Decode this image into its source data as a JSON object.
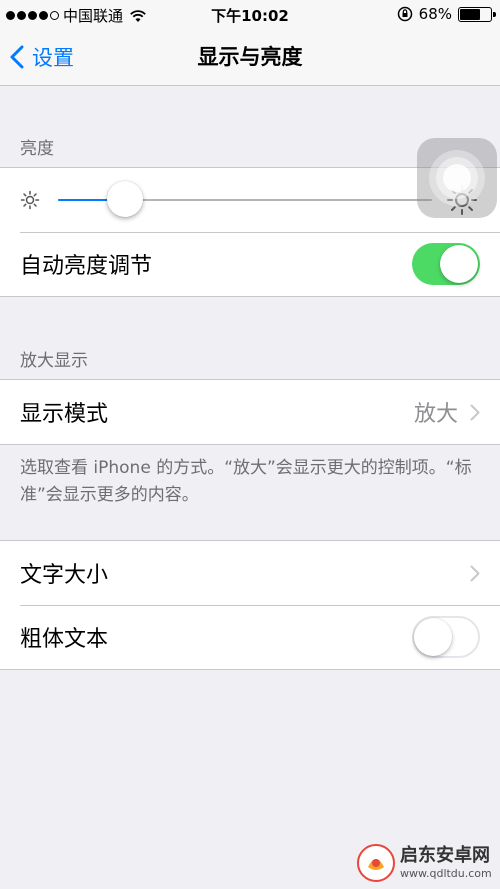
{
  "status_bar": {
    "carrier": "中国联通",
    "time": "下午10:02",
    "battery_percent": "68%",
    "battery_level": 0.68,
    "icons": [
      "signal-dots",
      "wifi-icon",
      "rotation-lock-icon",
      "battery-icon"
    ]
  },
  "nav": {
    "back_label": "设置",
    "title": "显示与亮度"
  },
  "brightness_section": {
    "header": "亮度",
    "slider_value": 0.18,
    "auto_brightness_label": "自动亮度调节",
    "auto_brightness_on": true
  },
  "zoom_section": {
    "header": "放大显示",
    "display_mode_label": "显示模式",
    "display_mode_value": "放大",
    "footer": "选取查看 iPhone 的方式。“放大”会显示更大的控制项。“标准”会显示更多的内容。"
  },
  "text_section": {
    "text_size_label": "文字大小",
    "bold_text_label": "粗体文本",
    "bold_text_on": false
  },
  "watermark": {
    "title": "启东安卓网",
    "url": "www.qdltdu.com"
  },
  "colors": {
    "accent": "#007aff",
    "toggle_on": "#4cd964",
    "background": "#efeff4"
  }
}
